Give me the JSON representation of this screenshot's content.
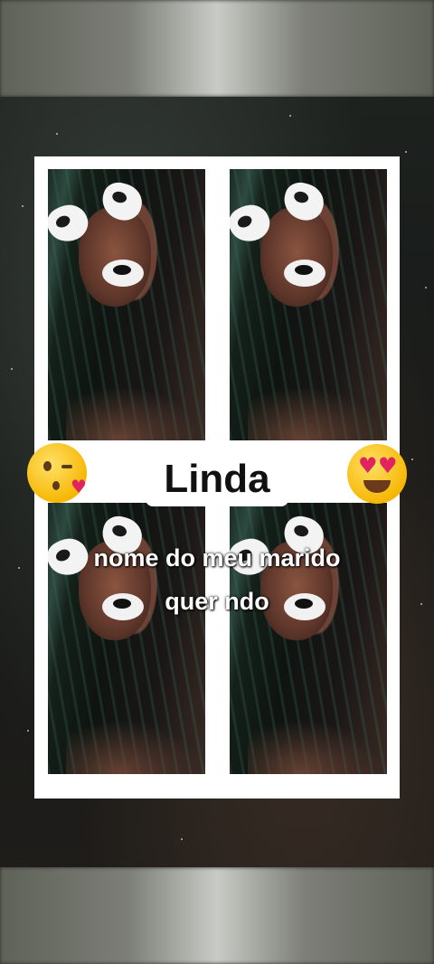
{
  "name_label": "Linda",
  "caption": {
    "line1": "nome do meu marido",
    "line2": "quer ndo"
  },
  "emojis": {
    "left": "kissing-face-emoji",
    "right": "heart-eyes-emoji"
  },
  "colors": {
    "frame": "#ffffff",
    "caption_text": "#ffffff",
    "name_text": "#111111"
  }
}
